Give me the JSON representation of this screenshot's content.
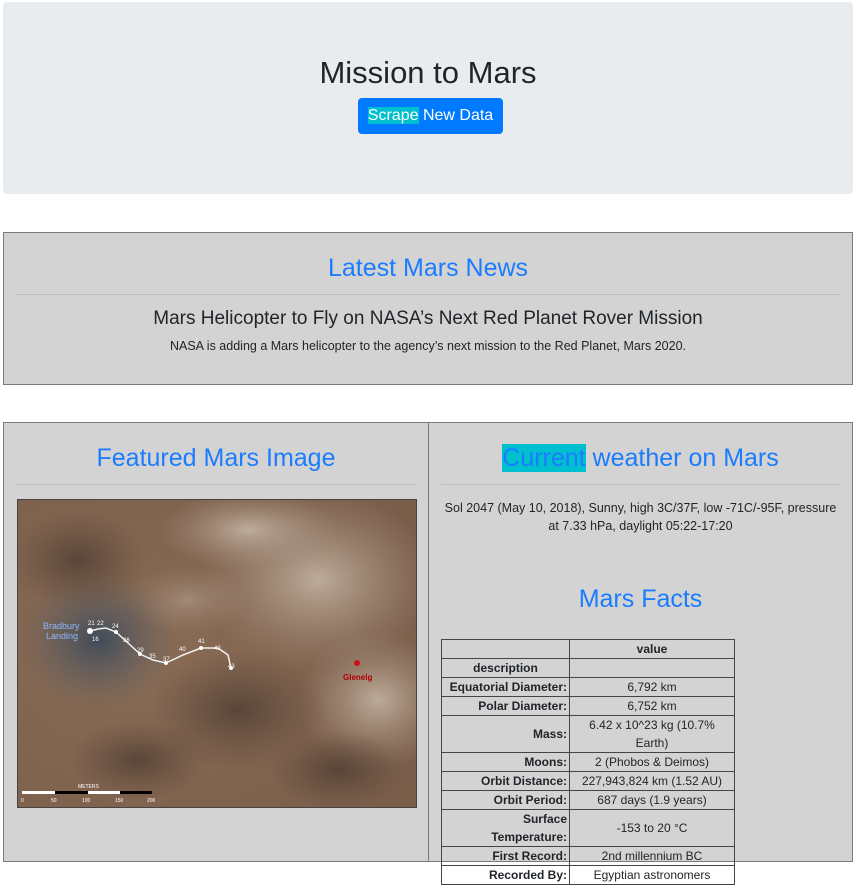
{
  "header": {
    "title": "Mission to Mars",
    "button_highlight": "Scrape",
    "button_rest": " New Data"
  },
  "news": {
    "heading": "Latest Mars News",
    "title": "Mars Helicopter to Fly on NASA’s Next Red Planet Rover Mission",
    "body": "NASA is adding a Mars helicopter to the agency’s next mission to the Red Planet, Mars 2020."
  },
  "featured": {
    "heading": "Featured Mars Image",
    "map_labels": {
      "landing": "Bradbury Landing",
      "landing_line1": "Bradbury",
      "landing_line2": "Landing",
      "target": "Glenelg",
      "scale_unit": "METERS",
      "scale_ticks": [
        "0",
        "50",
        "100",
        "150",
        "200"
      ],
      "waypoints": [
        "21",
        "22",
        "24",
        "16",
        "26",
        "29",
        "35",
        "37",
        "40",
        "41",
        "42",
        "43"
      ]
    }
  },
  "weather": {
    "heading_highlight": "Current",
    "heading_rest": " weather on Mars",
    "text": "Sol 2047 (May 10, 2018), Sunny, high 3C/37F, low -71C/-95F, pressure at 7.33 hPa, daylight 05:22-17:20"
  },
  "facts": {
    "heading": "Mars Facts",
    "column_header": "value",
    "index_label": "description",
    "rows": [
      {
        "label": "Equatorial Diameter:",
        "value": "6,792 km"
      },
      {
        "label": "Polar Diameter:",
        "value": "6,752 km"
      },
      {
        "label": "Mass:",
        "value": "6.42 x 10^23 kg (10.7% Earth)"
      },
      {
        "label": "Moons:",
        "value": "2 (Phobos & Deimos)"
      },
      {
        "label": "Orbit Distance:",
        "value": "227,943,824 km (1.52 AU)"
      },
      {
        "label": "Orbit Period:",
        "value": "687 days (1.9 years)"
      },
      {
        "label": "Surface Temperature:",
        "value": "-153 to 20 °C"
      },
      {
        "label": "First Record:",
        "value": "2nd millennium BC"
      },
      {
        "label": "Recorded By:",
        "value": "Egyptian astronomers"
      }
    ]
  },
  "colors": {
    "accent": "#007bff",
    "heading_blue": "#1a7cff",
    "highlight": "#00c0d0",
    "panel_bg": "#d3d3d3",
    "jumbotron_bg": "#e9ecef"
  }
}
